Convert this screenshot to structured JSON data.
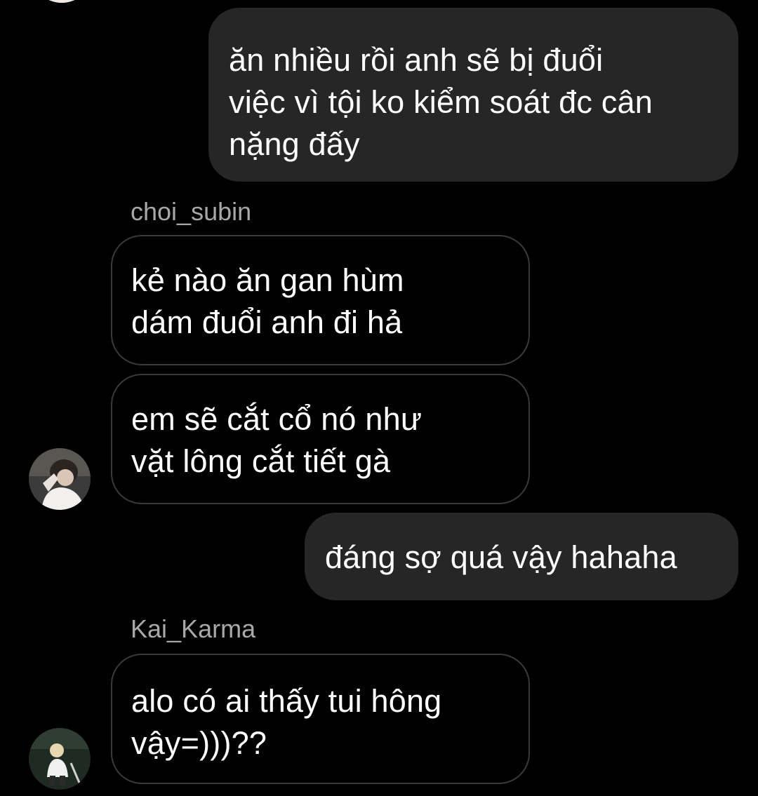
{
  "conversation": {
    "messages": [
      {
        "direction": "outgoing",
        "text": "ăn nhiều rồi anh sẽ bị đuổi\nviệc vì tội ko kiểm soát đc cân\nnặng đấy"
      },
      {
        "direction": "incoming",
        "sender": "choi_subin",
        "text": "kẻ nào ăn gan hùm\ndám đuổi anh đi hả"
      },
      {
        "direction": "incoming",
        "text": "em sẽ cắt cổ nó như\nvặt lông cắt tiết gà"
      },
      {
        "direction": "outgoing",
        "text": "đáng sợ quá vậy hahaha"
      },
      {
        "direction": "incoming",
        "sender": "Kai_Karma",
        "text": "alo có ai thấy tui hông\nvậy=)))??"
      }
    ]
  },
  "theme": {
    "background": "#000000",
    "outgoing_bubble": "#262626",
    "incoming_border": "#3a3a3a",
    "sender_name_color": "#a8a8a8"
  }
}
